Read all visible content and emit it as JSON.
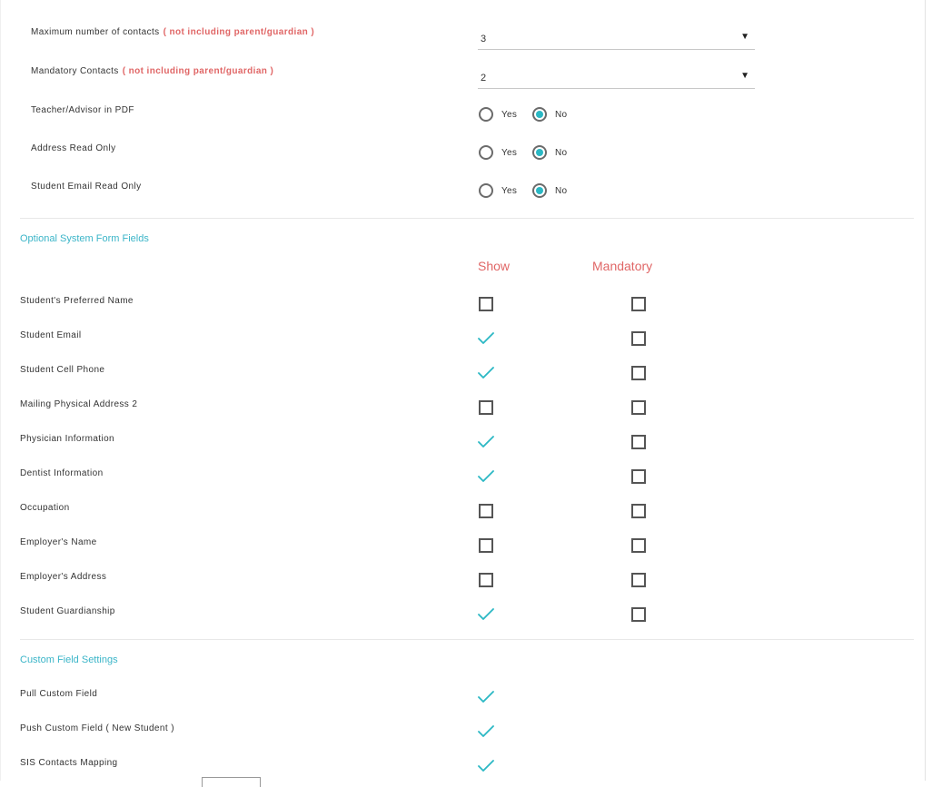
{
  "settings": [
    {
      "label": "Maximum number of contacts",
      "note": "( not including parent/guardian )",
      "type": "select",
      "value": "3"
    },
    {
      "label": "Mandatory Contacts",
      "note": "( not including parent/guardian )",
      "type": "select",
      "value": "2"
    },
    {
      "label": "Teacher/Advisor in PDF",
      "type": "radio",
      "yes": "Yes",
      "no": "No",
      "selected": "No"
    },
    {
      "label": "Address Read Only",
      "type": "radio",
      "yes": "Yes",
      "no": "No",
      "selected": "No"
    },
    {
      "label": "Student Email Read Only",
      "type": "radio",
      "yes": "Yes",
      "no": "No",
      "selected": "No"
    }
  ],
  "optional_fields": {
    "title": "Optional System Form Fields",
    "show_header": "Show",
    "mandatory_header": "Mandatory",
    "rows": [
      {
        "label": "Student's Preferred Name",
        "show": false,
        "mandatory": false
      },
      {
        "label": "Student Email",
        "show": true,
        "mandatory": false
      },
      {
        "label": "Student Cell Phone",
        "show": true,
        "mandatory": false
      },
      {
        "label": "Mailing Physical Address 2",
        "show": false,
        "mandatory": false
      },
      {
        "label": "Physician Information",
        "show": true,
        "mandatory": false
      },
      {
        "label": "Dentist Information",
        "show": true,
        "mandatory": false
      },
      {
        "label": "Occupation",
        "show": false,
        "mandatory": false
      },
      {
        "label": "Employer's Name",
        "show": false,
        "mandatory": false
      },
      {
        "label": "Employer's Address",
        "show": false,
        "mandatory": false
      },
      {
        "label": "Student Guardianship",
        "show": true,
        "mandatory": false
      }
    ]
  },
  "custom_fields": {
    "title": "Custom Field Settings",
    "rows": [
      {
        "label": "Pull Custom Field",
        "checked": true
      },
      {
        "label": "Push Custom Field ( New Student )",
        "checked": true
      },
      {
        "label": "SIS Contacts Mapping",
        "checked": true
      }
    ]
  },
  "colors": {
    "accent": "#2bb8c4",
    "section_title": "#3bb5c8",
    "warning": "#e06666"
  }
}
